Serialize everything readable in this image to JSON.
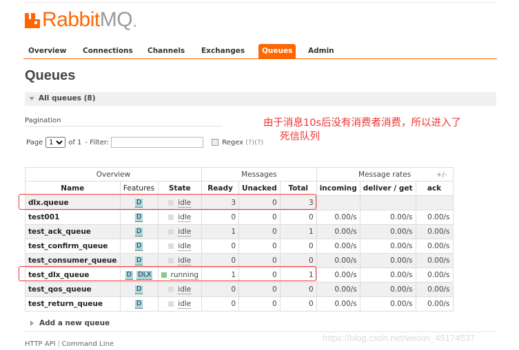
{
  "logo": {
    "rabbit": "Rabbit",
    "mq": "MQ"
  },
  "nav": {
    "items": [
      {
        "label": "Overview"
      },
      {
        "label": "Connections"
      },
      {
        "label": "Channels"
      },
      {
        "label": "Exchanges"
      },
      {
        "label": "Queues",
        "active": true
      },
      {
        "label": "Admin"
      }
    ]
  },
  "page_title": "Queues",
  "section": {
    "title": "All queues (8)"
  },
  "pagination": {
    "label": "Pagination",
    "page_label": "Page",
    "page_value": "1",
    "of_label": "of 1",
    "filter_label": "- Filter:",
    "filter_value": "",
    "regex_label": "Regex",
    "regex_help": "(?)(?)"
  },
  "annotation": {
    "line1": "由于消息10s后没有消费者消费，所以进入了",
    "line2": "死信队列"
  },
  "table": {
    "groups": {
      "overview": "Overview",
      "messages": "Messages",
      "rates": "Message rates",
      "plusminus": "+/-"
    },
    "columns": {
      "name": "Name",
      "features": "Features",
      "state": "State",
      "ready": "Ready",
      "unacked": "Unacked",
      "total": "Total",
      "incoming": "incoming",
      "deliver": "deliver / get",
      "ack": "ack"
    },
    "rows": [
      {
        "name": "dlx.queue",
        "features": [
          "D"
        ],
        "state": "idle",
        "ready": "3",
        "unacked": "0",
        "total": "3",
        "incoming": "",
        "deliver": "",
        "ack": ""
      },
      {
        "name": "test001",
        "features": [
          "D"
        ],
        "state": "idle",
        "ready": "0",
        "unacked": "0",
        "total": "0",
        "incoming": "0.00/s",
        "deliver": "0.00/s",
        "ack": "0.00/s"
      },
      {
        "name": "test_ack_queue",
        "features": [
          "D"
        ],
        "state": "idle",
        "ready": "1",
        "unacked": "0",
        "total": "1",
        "incoming": "0.00/s",
        "deliver": "0.00/s",
        "ack": "0.00/s"
      },
      {
        "name": "test_confirm_queue",
        "features": [
          "D"
        ],
        "state": "idle",
        "ready": "0",
        "unacked": "0",
        "total": "0",
        "incoming": "0.00/s",
        "deliver": "0.00/s",
        "ack": "0.00/s"
      },
      {
        "name": "test_consumer_queue",
        "features": [
          "D"
        ],
        "state": "idle",
        "ready": "0",
        "unacked": "0",
        "total": "0",
        "incoming": "0.00/s",
        "deliver": "0.00/s",
        "ack": "0.00/s"
      },
      {
        "name": "test_dlx_queue",
        "features": [
          "D",
          "DLX"
        ],
        "state": "running",
        "ready": "1",
        "unacked": "0",
        "total": "1",
        "incoming": "0.00/s",
        "deliver": "0.00/s",
        "ack": "0.00/s"
      },
      {
        "name": "test_qos_queue",
        "features": [
          "D"
        ],
        "state": "idle",
        "ready": "0",
        "unacked": "0",
        "total": "0",
        "incoming": "0.00/s",
        "deliver": "0.00/s",
        "ack": "0.00/s"
      },
      {
        "name": "test_return_queue",
        "features": [
          "D"
        ],
        "state": "idle",
        "ready": "0",
        "unacked": "0",
        "total": "0",
        "incoming": "0.00/s",
        "deliver": "0.00/s",
        "ack": "0.00/s"
      }
    ]
  },
  "add_queue": "Add a new queue",
  "footer": {
    "http_api": "HTTP API",
    "command_line": "Command Line"
  },
  "watermark": "https://blog.csdn.net/weixin_45174537",
  "colors": {
    "accent": "#ff6600",
    "annotation": "#ee3333",
    "feature_badge": "#a8d8d8",
    "running": "#88cc88"
  }
}
